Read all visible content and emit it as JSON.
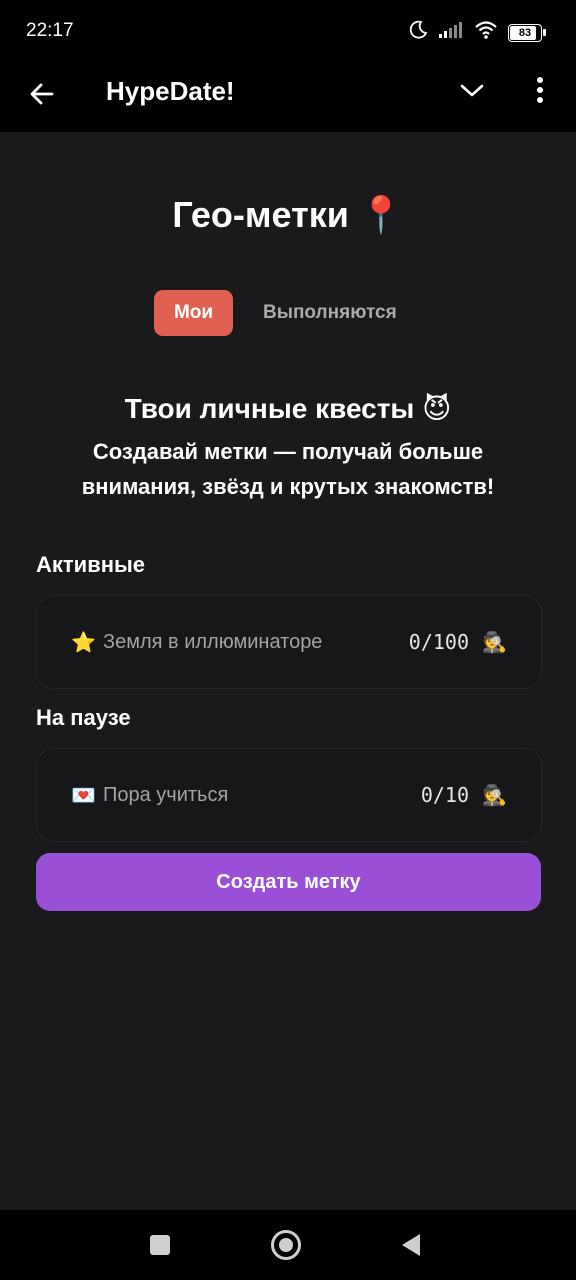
{
  "status_bar": {
    "time": "22:17",
    "battery": "83",
    "icons": [
      "moon-icon",
      "signal-icon",
      "wifi-icon",
      "battery-icon"
    ]
  },
  "app_bar": {
    "title": "HypeDate!",
    "icons": [
      "back-arrow-icon",
      "chevron-down-icon",
      "more-vert-icon"
    ]
  },
  "page": {
    "title": "Гео-метки 📍"
  },
  "tabs": [
    {
      "label": "Мои",
      "active": true
    },
    {
      "label": "Выполняются",
      "active": false
    }
  ],
  "promo": {
    "title": "Твои личные квесты 😈",
    "text": "Создавай метки — получай больше внимания, звёзд и крутых знакомств!"
  },
  "sections": [
    {
      "label": "Активные",
      "quests": [
        {
          "emoji": "⭐",
          "name": "Земля в иллюминаторе",
          "count": "0/100",
          "icon": "🕵️"
        }
      ]
    },
    {
      "label": "На паузе",
      "quests": [
        {
          "emoji": "💌",
          "name": "Пора учиться",
          "count": "0/10",
          "icon": "🕵️"
        }
      ]
    }
  ],
  "create_button": {
    "label": "Создать метку"
  },
  "colors": {
    "background": "#1a1a1c",
    "tab_active": "#e06052",
    "create_button": "#9a4fd7",
    "card": "#17171a"
  },
  "nav_bar": {
    "icons": [
      "recent-apps-icon",
      "home-icon",
      "back-triangle-icon"
    ]
  }
}
